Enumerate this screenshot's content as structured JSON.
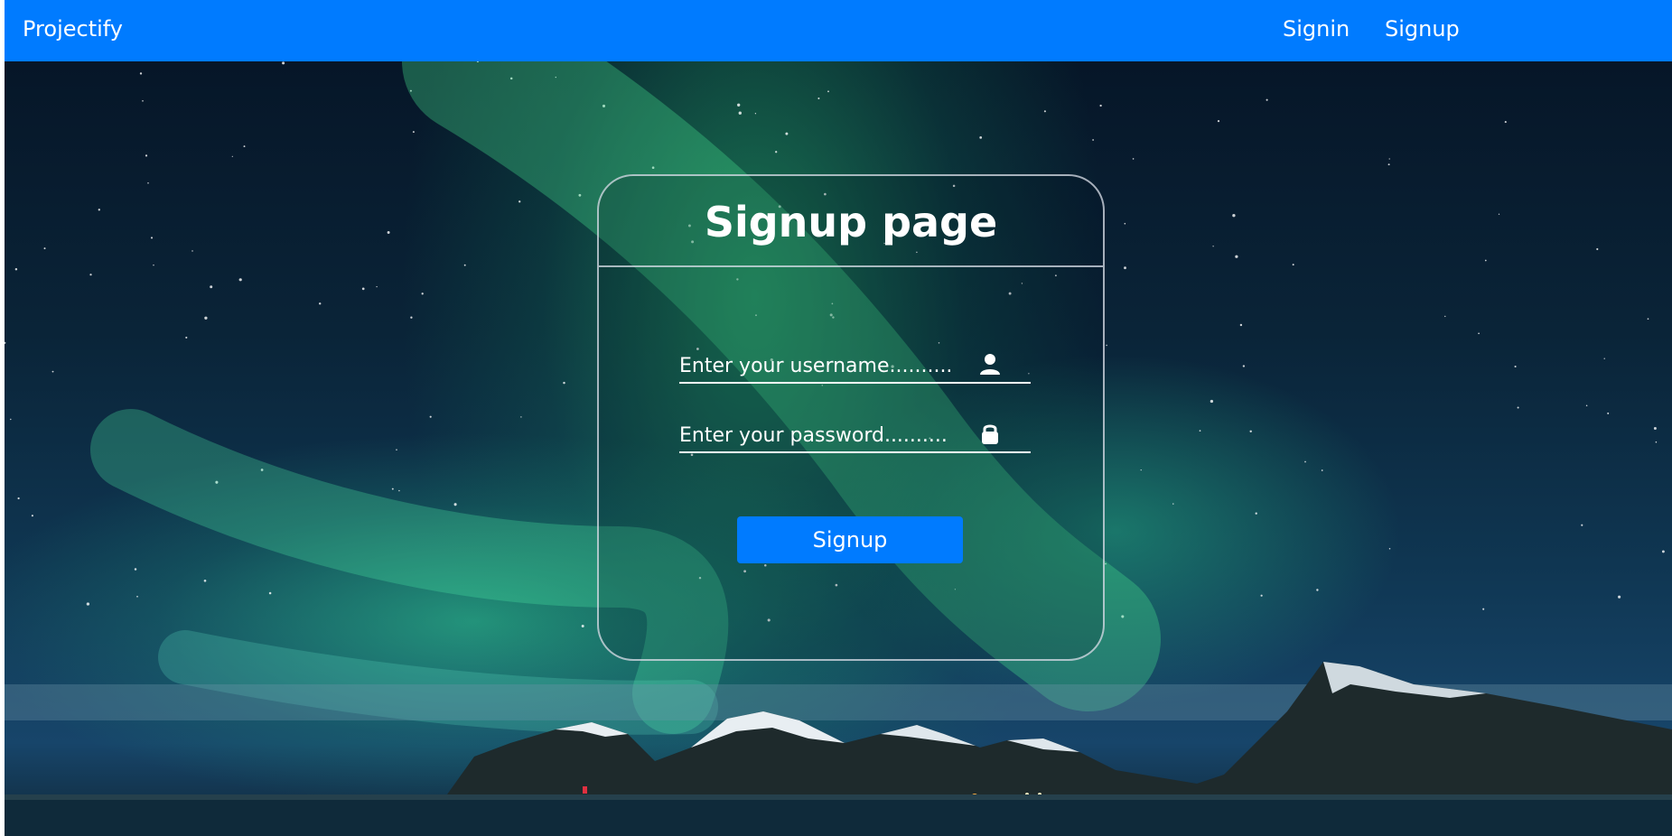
{
  "navbar": {
    "brand": "Projectify",
    "links": [
      {
        "label": "Signin"
      },
      {
        "label": "Signup"
      }
    ],
    "bg_color": "#007bff"
  },
  "form": {
    "title": "Signup page",
    "username": {
      "value": "",
      "placeholder": "Enter your username..........",
      "icon": "user-icon"
    },
    "password": {
      "value": "",
      "placeholder": "Enter your password..........",
      "icon": "lock-icon"
    },
    "submit_label": "Signup"
  },
  "background": {
    "description_icon": "aurora-landscape-image"
  }
}
